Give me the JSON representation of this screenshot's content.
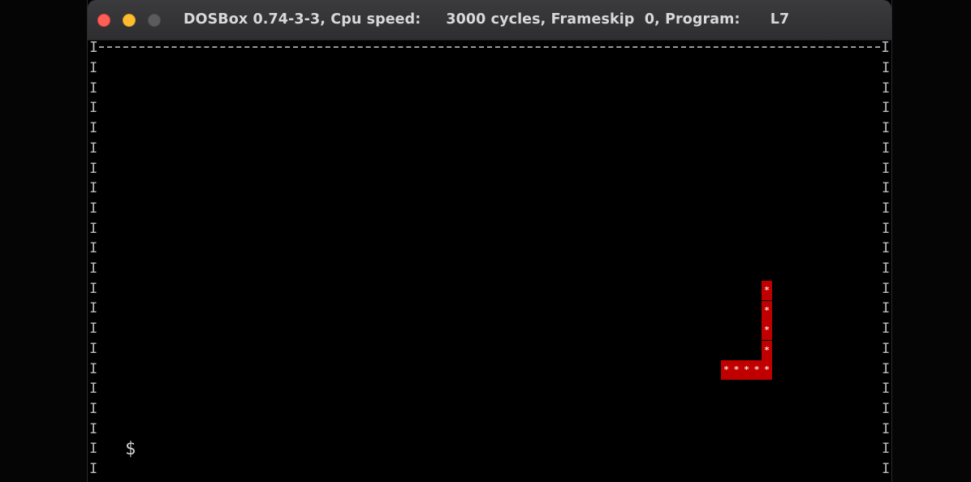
{
  "window": {
    "title": "DOSBox 0.74-3-3, Cpu speed:     3000 cycles, Frameskip  0, Program:      L7"
  },
  "traffic_lights": {
    "close": "#ff5f57",
    "minimize": "#febc2e",
    "zoom": "#5b5b5d"
  },
  "screen": {
    "border_corner": "I",
    "wall_char": "I",
    "prompt_char": "$",
    "snake_char": "*",
    "snake_color": "#c00000"
  },
  "snake": {
    "segments": [
      {
        "col": 0,
        "row": 0
      },
      {
        "col": 0,
        "row": 1
      },
      {
        "col": 0,
        "row": 2
      },
      {
        "col": 0,
        "row": 3
      },
      {
        "col": 0,
        "row": 4
      },
      {
        "col": -1,
        "row": 4
      },
      {
        "col": -2,
        "row": 4
      },
      {
        "col": -3,
        "row": 4
      },
      {
        "col": -4,
        "row": 4
      }
    ]
  }
}
